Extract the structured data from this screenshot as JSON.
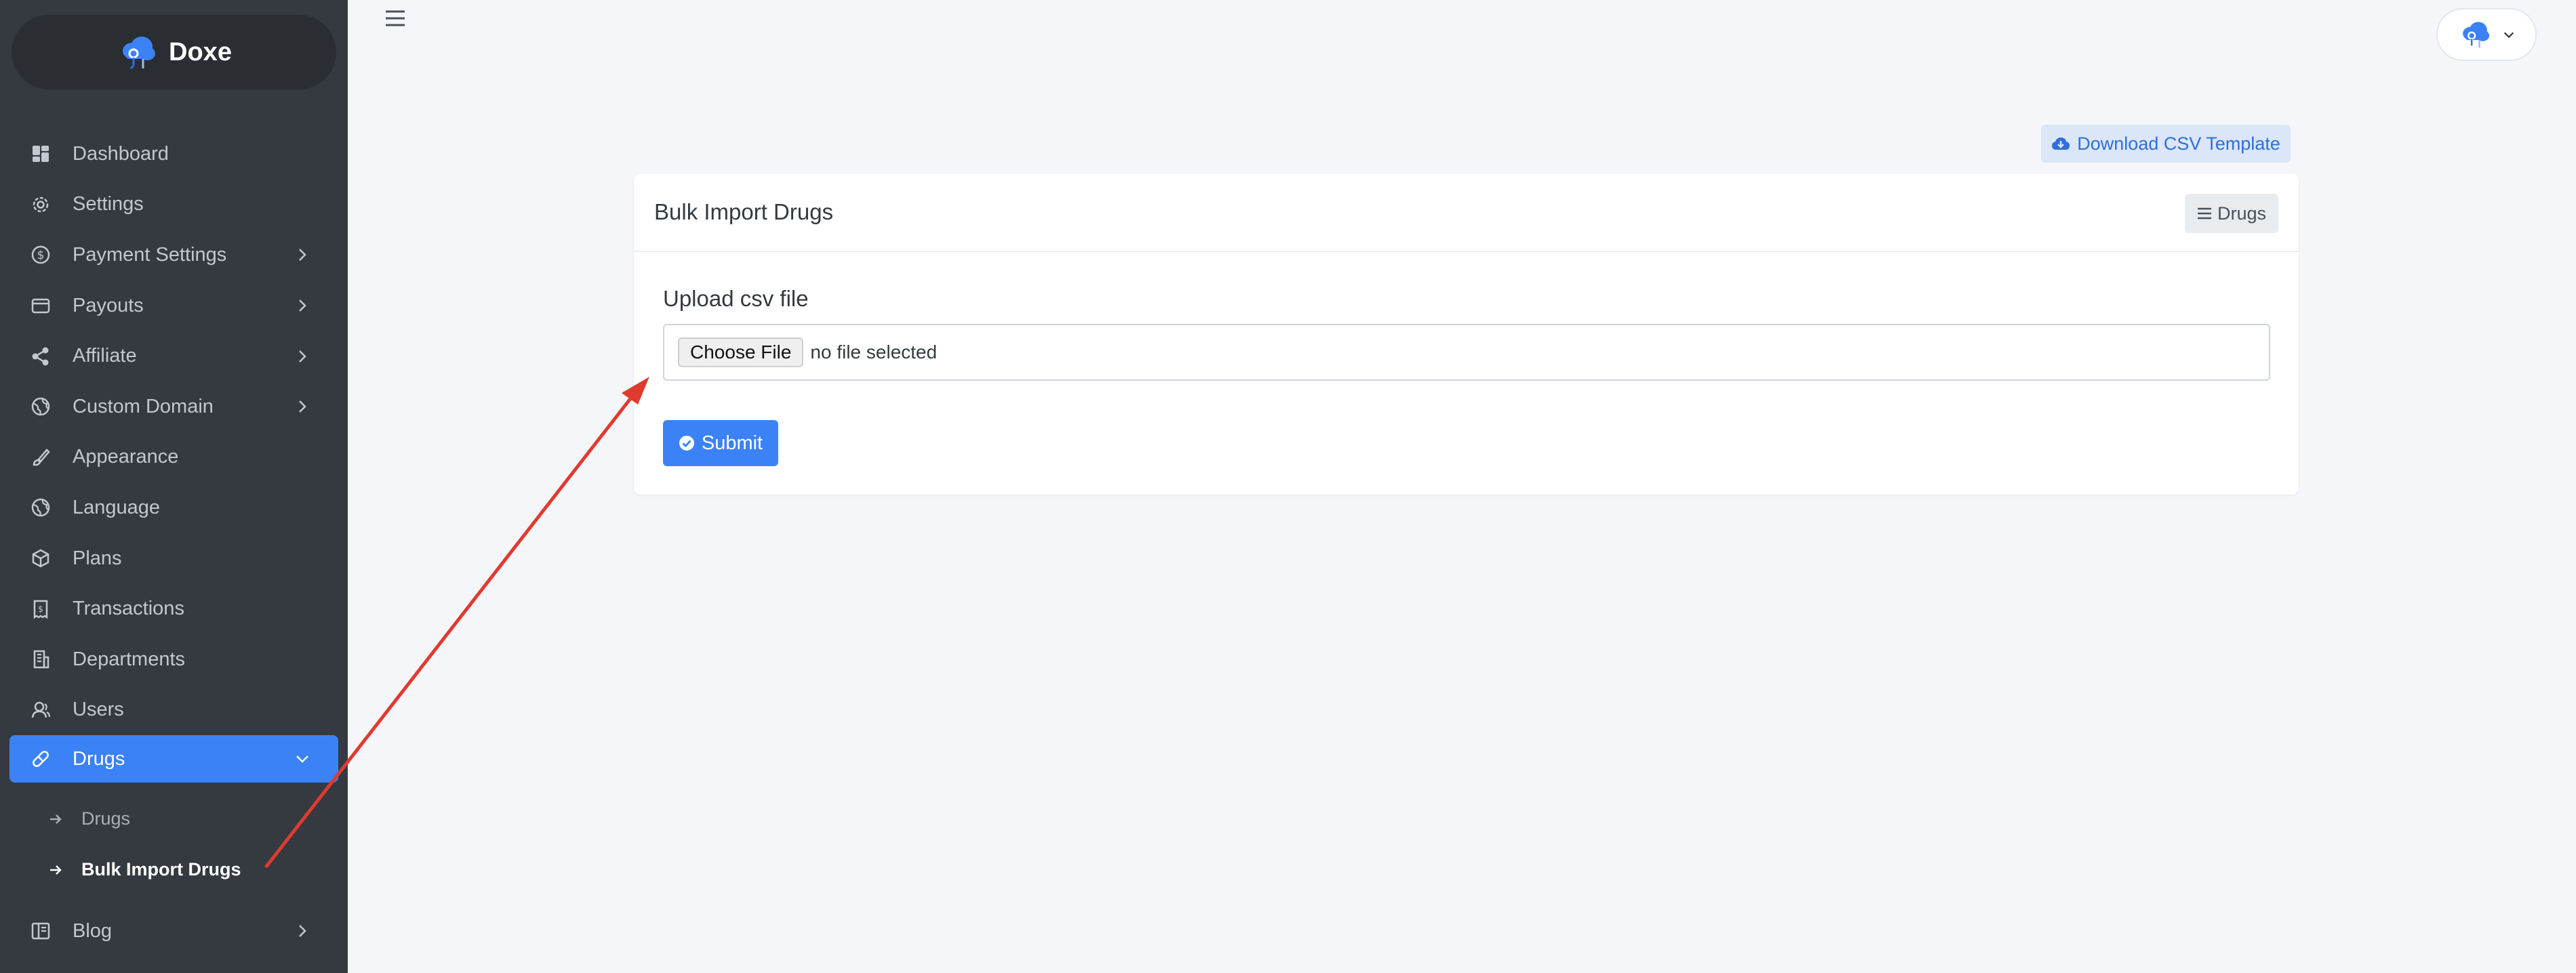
{
  "brand": {
    "name": "Doxe"
  },
  "sidebar": {
    "items": [
      {
        "label": "Dashboard",
        "icon": "dashboard-icon",
        "has_submenu": false
      },
      {
        "label": "Settings",
        "icon": "gear-icon",
        "has_submenu": false
      },
      {
        "label": "Payment Settings",
        "icon": "dollar-circle-icon",
        "has_submenu": true
      },
      {
        "label": "Payouts",
        "icon": "wallet-icon",
        "has_submenu": true
      },
      {
        "label": "Affiliate",
        "icon": "share-icon",
        "has_submenu": true
      },
      {
        "label": "Custom Domain",
        "icon": "globe-icon",
        "has_submenu": true
      },
      {
        "label": "Appearance",
        "icon": "brush-icon",
        "has_submenu": false
      },
      {
        "label": "Language",
        "icon": "globe-icon",
        "has_submenu": false
      },
      {
        "label": "Plans",
        "icon": "box-icon",
        "has_submenu": false
      },
      {
        "label": "Transactions",
        "icon": "receipt-icon",
        "has_submenu": false
      },
      {
        "label": "Departments",
        "icon": "building-icon",
        "has_submenu": false
      },
      {
        "label": "Users",
        "icon": "users-icon",
        "has_submenu": false
      },
      {
        "label": "Drugs",
        "icon": "pill-icon",
        "has_submenu": true,
        "expanded": true
      },
      {
        "label": "Blog",
        "icon": "book-icon",
        "has_submenu": true
      }
    ],
    "drugs_submenu": [
      {
        "label": "Drugs",
        "current": false
      },
      {
        "label": "Bulk Import Drugs",
        "current": true
      }
    ]
  },
  "toolbar": {
    "download_label": "Download CSV Template"
  },
  "card": {
    "title": "Bulk Import Drugs",
    "drugs_button_label": "Drugs",
    "upload_label": "Upload csv file",
    "choose_file_label": "Choose File",
    "file_status": "no file selected",
    "submit_label": "Submit"
  },
  "colors": {
    "sidebar_bg": "#343a40",
    "accent": "#3b82f6",
    "annotation_arrow": "#e03a2f"
  }
}
